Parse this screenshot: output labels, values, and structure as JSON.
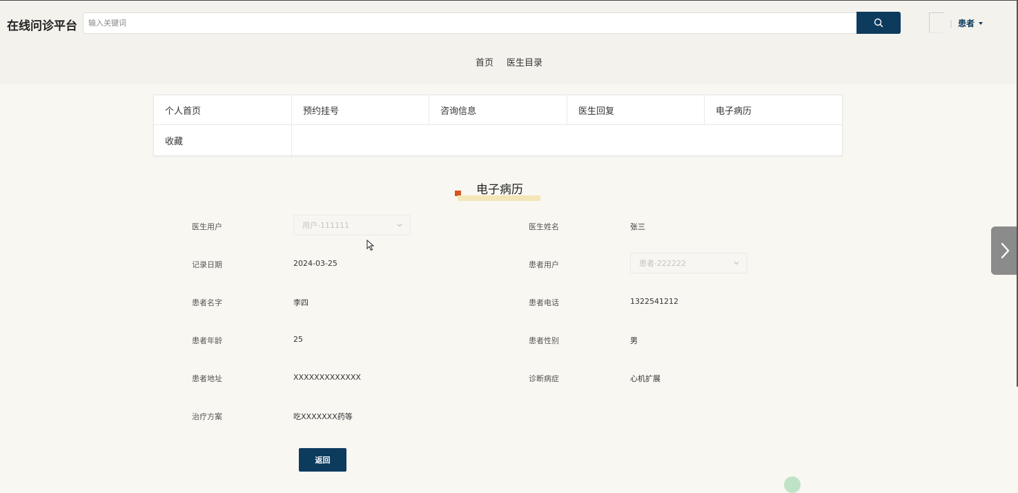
{
  "app": {
    "title": "在线问诊平台"
  },
  "search": {
    "placeholder": "输入关键词",
    "button_icon": "search-icon"
  },
  "user": {
    "role_label": "患者",
    "separator": "|"
  },
  "topnav": {
    "items": [
      "首页",
      "医生目录"
    ]
  },
  "menu": {
    "items": [
      "个人首页",
      "预约挂号",
      "咨询信息",
      "医生回复",
      "电子病历",
      "收藏"
    ]
  },
  "page": {
    "title": "电子病历"
  },
  "record": {
    "doctor_user_label": "医生用户",
    "doctor_user_value": "用户-111111",
    "doctor_name_label": "医生姓名",
    "doctor_name_value": "张三",
    "record_date_label": "记录日期",
    "record_date_value": "2024-03-25",
    "patient_user_label": "患者用户",
    "patient_user_value": "患者-222222",
    "patient_name_label": "患者名字",
    "patient_name_value": "李四",
    "patient_phone_label": "患者电话",
    "patient_phone_value": "1322541212",
    "patient_age_label": "患者年龄",
    "patient_age_value": "25",
    "patient_gender_label": "患者性别",
    "patient_gender_value": "男",
    "patient_address_label": "患者地址",
    "patient_address_value": "XXXXXXXXXXXXX",
    "diagnosis_label": "诊断病症",
    "diagnosis_value": "心机扩展",
    "treatment_label": "治疗方案",
    "treatment_value": "吃XXXXXXX药等"
  },
  "actions": {
    "back_label": "返回"
  },
  "colors": {
    "primary": "#0d3b5e",
    "accent": "#d9541f",
    "highlight": "#f5e6b8"
  }
}
